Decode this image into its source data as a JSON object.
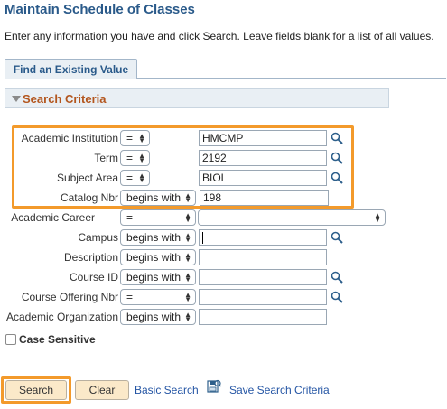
{
  "page": {
    "title": "Maintain Schedule of Classes",
    "instructions": "Enter any information you have and click Search. Leave fields blank for a list of all values."
  },
  "tabs": [
    {
      "label": "Find an Existing Value"
    }
  ],
  "section": {
    "title": "Search Criteria"
  },
  "fields": [
    {
      "label": "Academic Institution",
      "operator": "=",
      "value": "HMCMP"
    },
    {
      "label": "Term",
      "operator": "=",
      "value": "2192"
    },
    {
      "label": "Subject Area",
      "operator": "=",
      "value": "BIOL"
    },
    {
      "label": "Catalog Nbr",
      "operator": "begins with",
      "value": "198"
    },
    {
      "label": "Academic Career",
      "operator": "=",
      "value": ""
    },
    {
      "label": "Campus",
      "operator": "begins with",
      "value": ""
    },
    {
      "label": "Description",
      "operator": "begins with",
      "value": ""
    },
    {
      "label": "Course ID",
      "operator": "begins with",
      "value": ""
    },
    {
      "label": "Course Offering Nbr",
      "operator": "=",
      "value": ""
    },
    {
      "label": "Academic Organization",
      "operator": "begins with",
      "value": ""
    }
  ],
  "case_sensitive": {
    "label": "Case Sensitive",
    "checked": false
  },
  "actions": {
    "search": "Search",
    "clear": "Clear",
    "basic_search": "Basic Search",
    "save_criteria": "Save Search Criteria"
  },
  "colors": {
    "highlight": "#f39a2b",
    "title": "#2a5a8a",
    "section_title": "#b3561e",
    "link": "#2455a4",
    "button": "#fbe9c9"
  },
  "icons": {
    "lookup": "magnifier-icon",
    "save": "save-criteria-icon",
    "collapse": "triangle-down-icon",
    "dropdown": "updown-arrows-icon"
  }
}
